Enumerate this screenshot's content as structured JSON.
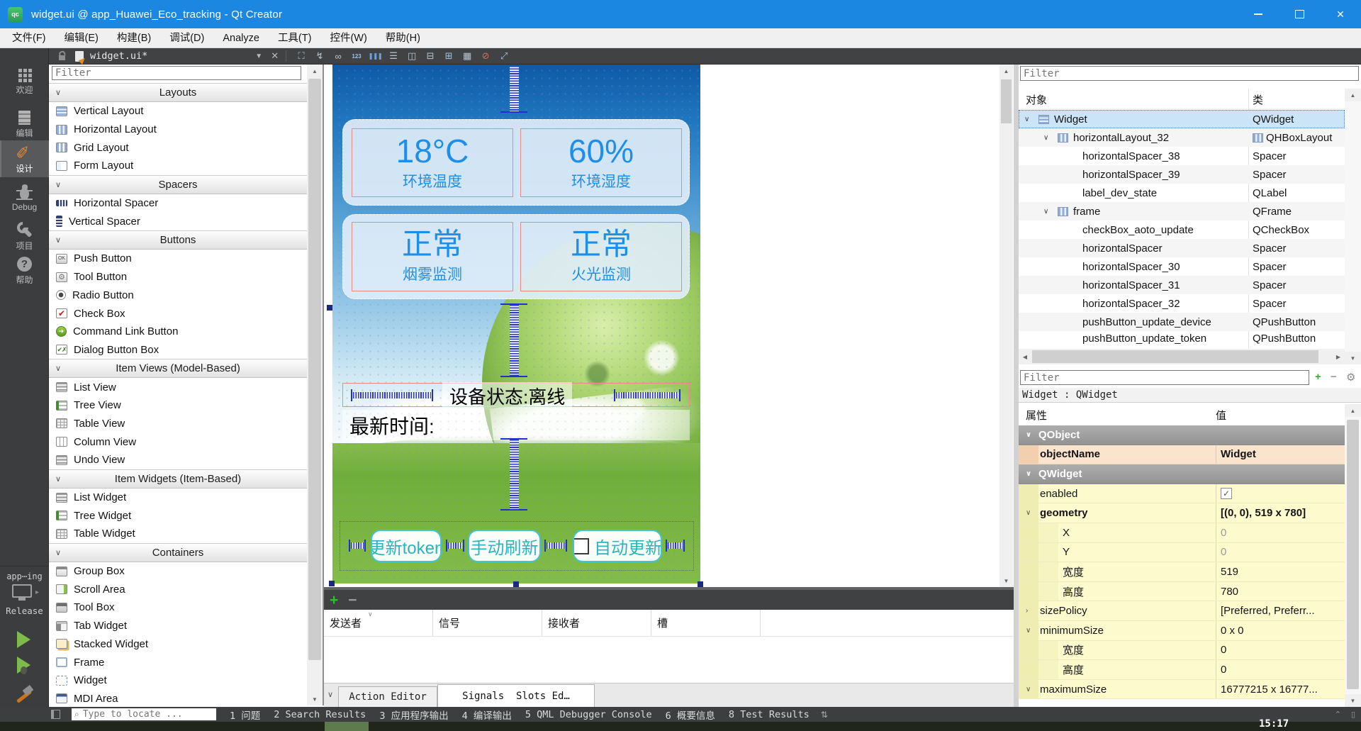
{
  "window": {
    "title": "widget.ui @ app_Huawei_Eco_tracking - Qt Creator",
    "app_icon": "qt-creator-icon"
  },
  "menubar": [
    "文件(F)",
    "编辑(E)",
    "构建(B)",
    "调试(D)",
    "Analyze",
    "工具(T)",
    "控件(W)",
    "帮助(H)"
  ],
  "docbar": {
    "doc_title": "widget.ui*",
    "icons": [
      {
        "name": "edit-widgets-icon",
        "glyph": "⛶",
        "color": "#9fc0e0"
      },
      {
        "name": "edit-signals-slots-icon",
        "glyph": "↯",
        "color": "#b9c4ce"
      },
      {
        "name": "edit-buddies-icon",
        "glyph": "∞",
        "color": "#b9c4ce"
      },
      {
        "name": "edit-tab-order-icon",
        "glyph": "123",
        "color": "#9fc0e0"
      },
      {
        "name": "layout-horizontal-icon",
        "glyph": "❚❚❚",
        "color": "#6f9fd8"
      },
      {
        "name": "layout-vertical-icon",
        "glyph": "☰",
        "color": "#b9c4ce"
      },
      {
        "name": "layout-split-horizontal-icon",
        "glyph": "◫",
        "color": "#b9c4ce"
      },
      {
        "name": "layout-split-vertical-icon",
        "glyph": "⊟",
        "color": "#b9c4ce"
      },
      {
        "name": "layout-form-icon",
        "glyph": "⊞",
        "color": "#9fc0e0"
      },
      {
        "name": "layout-grid-icon",
        "glyph": "▦",
        "color": "#b9c4ce"
      },
      {
        "name": "break-layout-icon",
        "glyph": "⊘",
        "color": "#d26a5a"
      },
      {
        "name": "adjust-size-icon",
        "glyph": "⤢",
        "color": "#9fc0e0"
      }
    ]
  },
  "mode_sidebar": {
    "modes": [
      {
        "label": "欢迎",
        "icon": "welcome-grid-icon",
        "active": false
      },
      {
        "label": "编辑",
        "icon": "edit-document-icon",
        "active": false
      },
      {
        "label": "设计",
        "icon": "design-pencil-icon",
        "active": true
      },
      {
        "label": "Debug",
        "icon": "debug-bug-icon",
        "active": false
      },
      {
        "label": "项目",
        "icon": "projects-wrench-icon",
        "active": false
      },
      {
        "label": "帮助",
        "icon": "help-circle-icon",
        "active": false
      }
    ],
    "kit_label": "app⋯ing",
    "build_config": "Release"
  },
  "widget_box": {
    "filter_placeholder": "Filter",
    "sections": [
      {
        "title": "Layouts",
        "items": [
          {
            "label": "Vertical Layout",
            "icon": "vertical-layout-icon"
          },
          {
            "label": "Horizontal Layout",
            "icon": "horizontal-layout-icon"
          },
          {
            "label": "Grid Layout",
            "icon": "grid-layout-icon"
          },
          {
            "label": "Form Layout",
            "icon": "form-layout-icon"
          }
        ]
      },
      {
        "title": "Spacers",
        "items": [
          {
            "label": "Horizontal Spacer",
            "icon": "horizontal-spacer-icon"
          },
          {
            "label": "Vertical Spacer",
            "icon": "vertical-spacer-icon"
          }
        ]
      },
      {
        "title": "Buttons",
        "items": [
          {
            "label": "Push Button",
            "icon": "push-button-icon"
          },
          {
            "label": "Tool Button",
            "icon": "tool-button-icon"
          },
          {
            "label": "Radio Button",
            "icon": "radio-button-icon"
          },
          {
            "label": "Check Box",
            "icon": "check-box-icon"
          },
          {
            "label": "Command Link Button",
            "icon": "command-link-button-icon"
          },
          {
            "label": "Dialog Button Box",
            "icon": "dialog-button-box-icon"
          }
        ]
      },
      {
        "title": "Item Views (Model-Based)",
        "items": [
          {
            "label": "List View",
            "icon": "list-view-icon"
          },
          {
            "label": "Tree View",
            "icon": "tree-view-icon"
          },
          {
            "label": "Table View",
            "icon": "table-view-icon"
          },
          {
            "label": "Column View",
            "icon": "column-view-icon"
          },
          {
            "label": "Undo View",
            "icon": "undo-view-icon"
          }
        ]
      },
      {
        "title": "Item Widgets (Item-Based)",
        "items": [
          {
            "label": "List Widget",
            "icon": "list-widget-icon"
          },
          {
            "label": "Tree Widget",
            "icon": "tree-widget-icon"
          },
          {
            "label": "Table Widget",
            "icon": "table-widget-icon"
          }
        ]
      },
      {
        "title": "Containers",
        "items": [
          {
            "label": "Group Box",
            "icon": "group-box-icon"
          },
          {
            "label": "Scroll Area",
            "icon": "scroll-area-icon"
          },
          {
            "label": "Tool Box",
            "icon": "tool-box-icon"
          },
          {
            "label": "Tab Widget",
            "icon": "tab-widget-icon"
          },
          {
            "label": "Stacked Widget",
            "icon": "stacked-widget-icon"
          },
          {
            "label": "Frame",
            "icon": "frame-icon"
          },
          {
            "label": "Widget",
            "icon": "widget-icon"
          },
          {
            "label": "MDI Area",
            "icon": "mdi-area-icon"
          }
        ]
      }
    ]
  },
  "form": {
    "metric_cards": [
      {
        "value": "18°C",
        "label": "环境温度"
      },
      {
        "value": "60%",
        "label": "环境湿度"
      }
    ],
    "status_cards": [
      {
        "value": "正常",
        "label": "烟雾监测"
      },
      {
        "value": "正常",
        "label": "火光监测"
      }
    ],
    "device_state": "设备状态:离线",
    "latest_time": "最新时间:",
    "buttons": [
      {
        "label": "更新token",
        "has_checkbox": false
      },
      {
        "label": "手动刷新",
        "has_checkbox": false
      },
      {
        "label": "自动更新",
        "has_checkbox": true
      }
    ],
    "accent_text_color": "#1e8fe8",
    "button_text_color": "#2ab5be"
  },
  "object_inspector": {
    "filter_placeholder": "Filter",
    "columns": [
      "对象",
      "类"
    ],
    "rows": [
      {
        "name": "Widget",
        "class": "QWidget",
        "depth": 0,
        "expand": true,
        "icon": "vertical-layout-icon",
        "class_icon": false,
        "selected": true
      },
      {
        "name": "horizontalLayout_32",
        "class": "QHBoxLayout",
        "depth": 1,
        "expand": true,
        "icon": "horizontal-layout-icon",
        "class_icon": true,
        "selected": false
      },
      {
        "name": "horizontalSpacer_38",
        "class": "Spacer",
        "depth": 2,
        "expand": false,
        "icon": "",
        "class_icon": false,
        "selected": false
      },
      {
        "name": "horizontalSpacer_39",
        "class": "Spacer",
        "depth": 2,
        "expand": false,
        "icon": "",
        "class_icon": false,
        "selected": false
      },
      {
        "name": "label_dev_state",
        "class": "QLabel",
        "depth": 2,
        "expand": false,
        "icon": "",
        "class_icon": false,
        "selected": false
      },
      {
        "name": "frame",
        "class": "QFrame",
        "depth": 1,
        "expand": true,
        "icon": "horizontal-layout-icon",
        "class_icon": false,
        "selected": false
      },
      {
        "name": "checkBox_aoto_update",
        "class": "QCheckBox",
        "depth": 2,
        "expand": false,
        "icon": "",
        "class_icon": false,
        "selected": false
      },
      {
        "name": "horizontalSpacer",
        "class": "Spacer",
        "depth": 2,
        "expand": false,
        "icon": "",
        "class_icon": false,
        "selected": false
      },
      {
        "name": "horizontalSpacer_30",
        "class": "Spacer",
        "depth": 2,
        "expand": false,
        "icon": "",
        "class_icon": false,
        "selected": false
      },
      {
        "name": "horizontalSpacer_31",
        "class": "Spacer",
        "depth": 2,
        "expand": false,
        "icon": "",
        "class_icon": false,
        "selected": false
      },
      {
        "name": "horizontalSpacer_32",
        "class": "Spacer",
        "depth": 2,
        "expand": false,
        "icon": "",
        "class_icon": false,
        "selected": false
      },
      {
        "name": "pushButton_update_device",
        "class": "QPushButton",
        "depth": 2,
        "expand": false,
        "icon": "",
        "class_icon": false,
        "selected": false
      },
      {
        "name": "pushButton_update_token",
        "class": "QPushButton",
        "depth": 2,
        "expand": false,
        "icon": "",
        "class_icon": false,
        "selected": false,
        "clipped": true
      }
    ]
  },
  "property_editor": {
    "filter_placeholder": "Filter",
    "selection_label": "Widget : QWidget",
    "columns": [
      "属性",
      "值"
    ],
    "toolbar_icons": [
      {
        "name": "add-property-icon",
        "glyph": "+",
        "color": "#2fae2f"
      },
      {
        "name": "remove-property-icon",
        "glyph": "−",
        "color": "#9a9a9a"
      },
      {
        "name": "property-settings-icon",
        "glyph": "⚙",
        "color": "#8a8a8a"
      }
    ],
    "rows": [
      {
        "type": "group",
        "name": "QObject",
        "value": ""
      },
      {
        "type": "prop",
        "name": "objectName",
        "value": "Widget",
        "bold": true,
        "theme": "peach",
        "expand": "",
        "dim": false,
        "checkbox": false
      },
      {
        "type": "group",
        "name": "QWidget",
        "value": ""
      },
      {
        "type": "prop",
        "name": "enabled",
        "value": "✓",
        "bold": false,
        "theme": "yellow",
        "expand": "",
        "dim": false,
        "checkbox": true
      },
      {
        "type": "prop",
        "name": "geometry",
        "value": "[(0, 0), 519 x 780]",
        "bold": true,
        "theme": "yellow",
        "expand": "open",
        "dim": false,
        "checkbox": false
      },
      {
        "type": "sub",
        "name": "X",
        "value": "0",
        "bold": false,
        "theme": "yellow",
        "expand": "",
        "dim": true,
        "checkbox": false
      },
      {
        "type": "sub",
        "name": "Y",
        "value": "0",
        "bold": false,
        "theme": "yellow",
        "expand": "",
        "dim": true,
        "checkbox": false
      },
      {
        "type": "sub",
        "name": "宽度",
        "value": "519",
        "bold": false,
        "theme": "yellow",
        "expand": "",
        "dim": false,
        "checkbox": false
      },
      {
        "type": "sub",
        "name": "高度",
        "value": "780",
        "bold": false,
        "theme": "yellow",
        "expand": "",
        "dim": false,
        "checkbox": false
      },
      {
        "type": "prop",
        "name": "sizePolicy",
        "value": "[Preferred, Preferr...",
        "bold": false,
        "theme": "yellow",
        "expand": "closed",
        "dim": false,
        "checkbox": false
      },
      {
        "type": "prop",
        "name": "minimumSize",
        "value": "0 x 0",
        "bold": false,
        "theme": "yellow",
        "expand": "open",
        "dim": false,
        "checkbox": false
      },
      {
        "type": "sub",
        "name": "宽度",
        "value": "0",
        "bold": false,
        "theme": "yellow",
        "expand": "",
        "dim": false,
        "checkbox": false
      },
      {
        "type": "sub",
        "name": "高度",
        "value": "0",
        "bold": false,
        "theme": "yellow",
        "expand": "",
        "dim": false,
        "checkbox": false
      },
      {
        "type": "prop",
        "name": "maximumSize",
        "value": "16777215 x 16777...",
        "bold": false,
        "theme": "yellow",
        "expand": "open",
        "dim": false,
        "checkbox": false
      }
    ]
  },
  "signal_slot_editor": {
    "columns": [
      "发送者",
      "信号",
      "接收者",
      "槽"
    ],
    "tabs": [
      {
        "label": "Action Editor",
        "active": false
      },
      {
        "label": "Signals  Slots Ed…",
        "active": true
      }
    ]
  },
  "status_bar": {
    "locator_placeholder": "Type to locate ...",
    "panes": [
      "1 问题",
      "2 Search Results",
      "3 应用程序输出",
      "4 编译输出",
      "5 QML Debugger Console",
      "6 概要信息",
      "8 Test Results"
    ]
  },
  "bottom_strip": {
    "clock": "15:17"
  }
}
